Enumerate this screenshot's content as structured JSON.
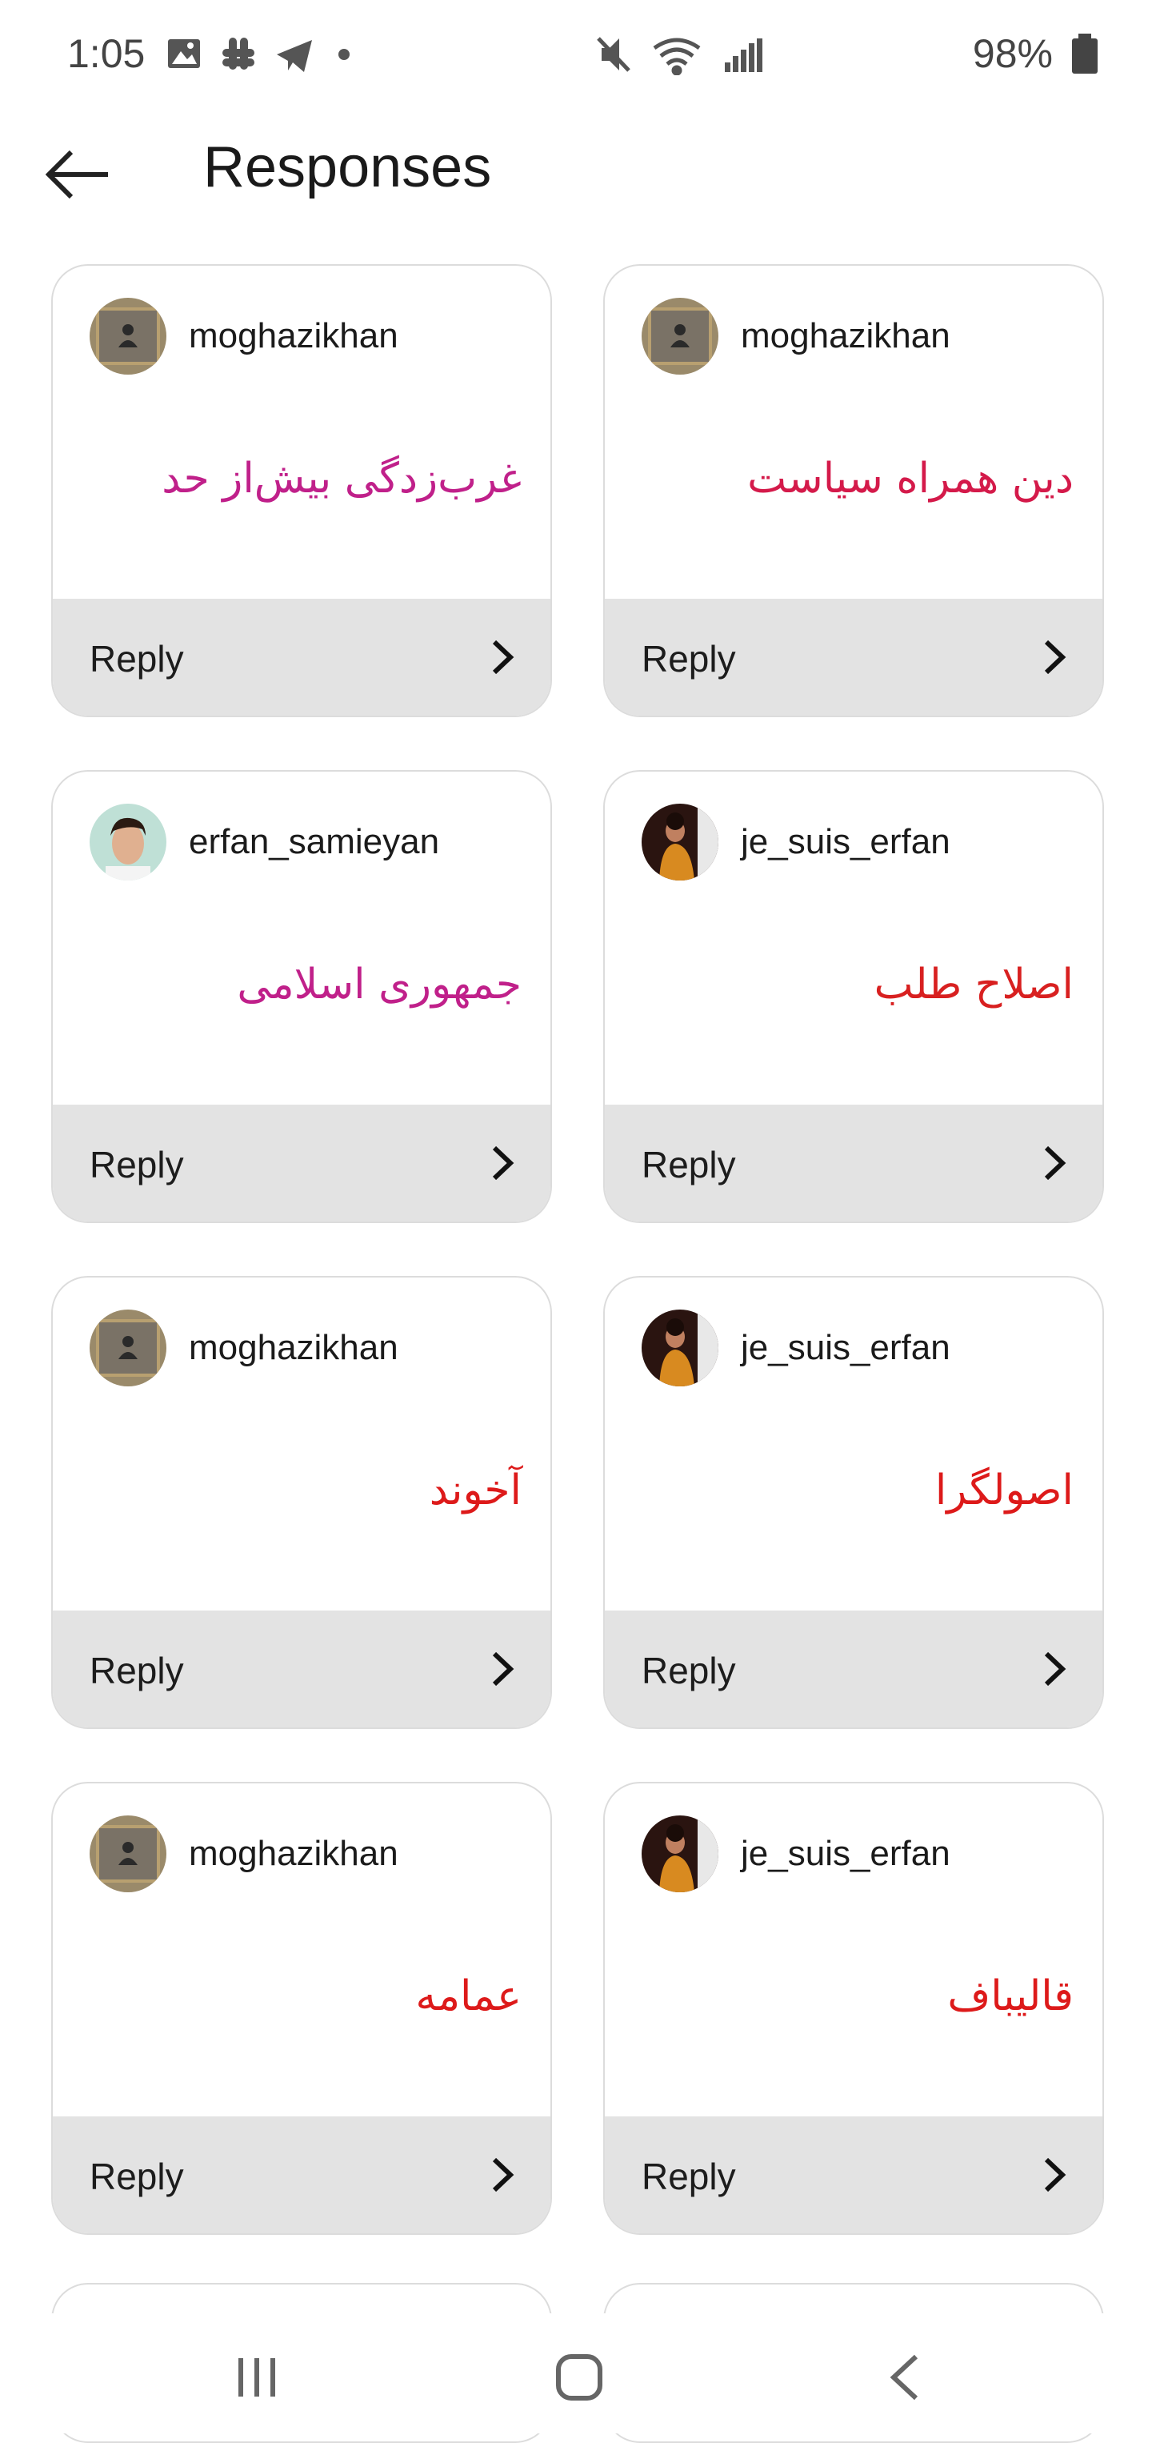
{
  "status_bar": {
    "time": "1:05",
    "battery": "98%",
    "icons": [
      "image-icon",
      "slack-icon",
      "telegram-icon",
      "dot-icon",
      "mute-icon",
      "wifi-icon",
      "signal-icon",
      "battery-icon"
    ]
  },
  "header": {
    "title": "Responses",
    "back_icon": "arrow-left-icon"
  },
  "cards": [
    {
      "username": "moghazikhan",
      "response": "غرب‌زدگی بیش‌از حد",
      "response_color": "#c0208a",
      "reply": "Reply"
    },
    {
      "username": "moghazikhan",
      "response": "دین همراه سیاست",
      "response_color": "#d41a4a",
      "reply": "Reply"
    },
    {
      "username": "erfan_samieyan",
      "response": "جمهوری اسلامی",
      "response_color": "#c0208a",
      "reply": "Reply"
    },
    {
      "username": "je_suis_erfan",
      "response": "اصلاح طلب",
      "response_color": "#d82020",
      "reply": "Reply"
    },
    {
      "username": "moghazikhan",
      "response": "آخوند",
      "response_color": "#dd1a1a",
      "reply": "Reply"
    },
    {
      "username": "je_suis_erfan",
      "response": "اصولگرا",
      "response_color": "#dd1a1a",
      "reply": "Reply"
    },
    {
      "username": "moghazikhan",
      "response": "عمامه",
      "response_color": "#dd1a1a",
      "reply": "Reply"
    },
    {
      "username": "je_suis_erfan",
      "response": "قالیباف",
      "response_color": "#dd1a1a",
      "reply": "Reply"
    }
  ],
  "nav": {
    "recents_icon": "recent-apps-icon",
    "home_icon": "home-icon",
    "back_icon": "back-icon"
  }
}
